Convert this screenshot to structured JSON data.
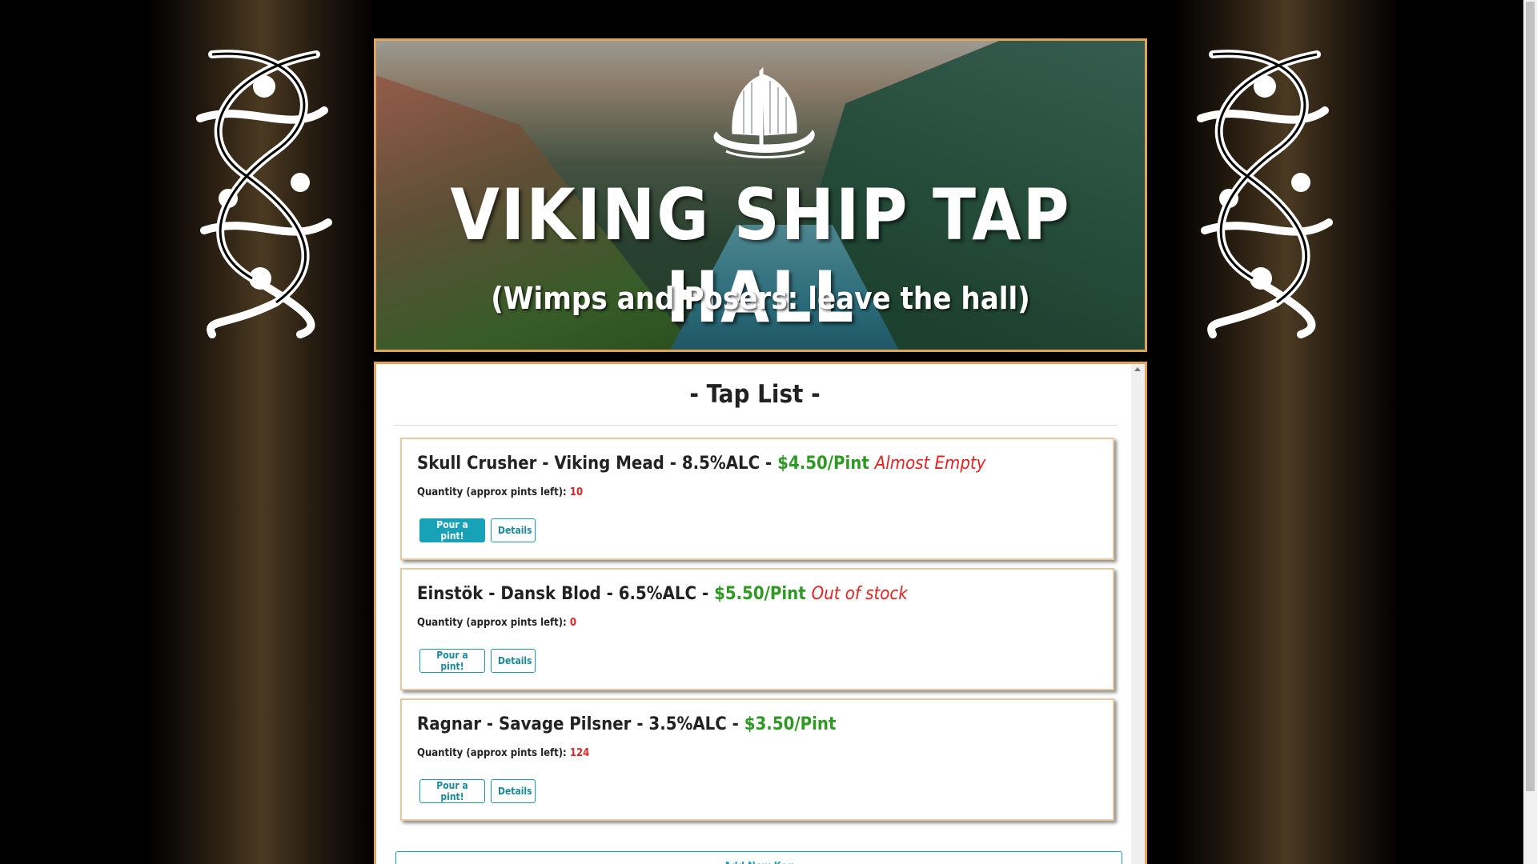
{
  "banner": {
    "title": "VIKING SHIP TAP HALL",
    "subtitle": "(Wimps and Posers: leave the hall)"
  },
  "tap_list": {
    "heading": "- Tap List -",
    "quantity_label": "Quantity (approx pints left):",
    "pour_label": "Pour a pint!",
    "details_label": "Details",
    "add_label": "Add New Keg",
    "kegs": [
      {
        "name": "Skull Crusher - Viking Mead - 8.5%ALC - ",
        "price": "$4.50/Pint",
        "status": "Almost Empty",
        "quantity": "10"
      },
      {
        "name": "Einstök - Dansk Blod - 6.5%ALC - ",
        "price": "$5.50/Pint",
        "status": "Out of stock",
        "quantity": "0"
      },
      {
        "name": "Ragnar - Savage Pilsner - 3.5%ALC - ",
        "price": "$3.50/Pint",
        "status": "",
        "quantity": "124"
      }
    ]
  },
  "colors": {
    "border_accent": "#e0a35a",
    "price_green": "#2e9a23",
    "alert_red": "#ea2020",
    "button_teal": "#17a2b8"
  },
  "icons": {
    "ornaments": "celtic-knot-dragon",
    "banner_emblem": "viking-longship"
  }
}
